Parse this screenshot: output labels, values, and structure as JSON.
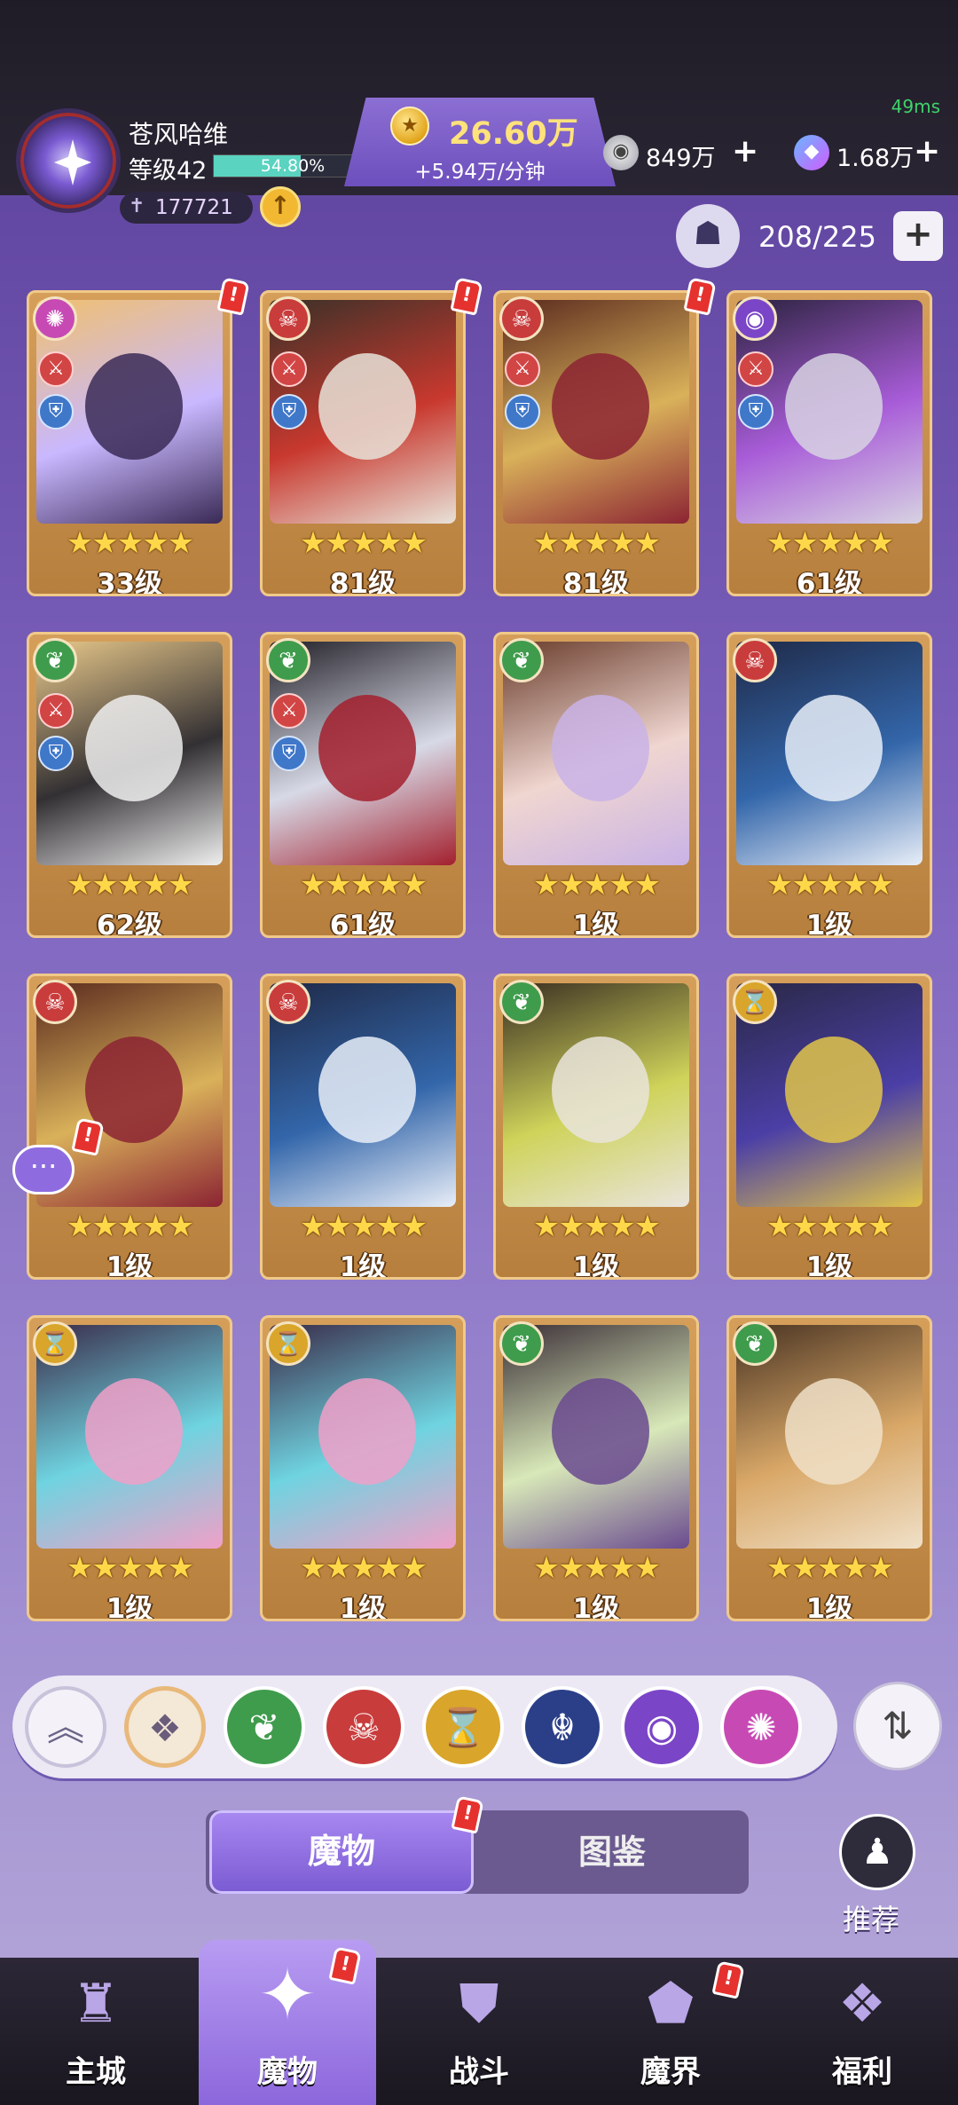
{
  "status": {
    "ping": "49ms"
  },
  "player": {
    "name": "苍风哈维",
    "level_label": "等级42",
    "xp_percent_text": "54.80%",
    "xp_fraction": 0.548,
    "power": "177721"
  },
  "gold": {
    "amount": "26.60万",
    "rate": "+5.94万/分钟"
  },
  "resources": {
    "silver": "849万",
    "gems": "1.68万"
  },
  "capacity": {
    "text": "208/225"
  },
  "cards": [
    {
      "level": "33级",
      "element": "wind-icon",
      "roles": [
        "attack",
        "defense"
      ],
      "alert": true,
      "art": [
        "#f0c070",
        "#c9b8ff",
        "#3a2a56"
      ]
    },
    {
      "level": "81级",
      "element": "fire-icon",
      "roles": [
        "attack",
        "defense"
      ],
      "alert": true,
      "art": [
        "#3a3128",
        "#c8382e",
        "#e8e2d8"
      ]
    },
    {
      "level": "81级",
      "element": "fire-icon",
      "roles": [
        "attack",
        "defense"
      ],
      "alert": true,
      "art": [
        "#5a2a1e",
        "#d9b15a",
        "#8c2433"
      ]
    },
    {
      "level": "61级",
      "element": "eye-icon",
      "roles": [
        "attack",
        "defense"
      ],
      "alert": false,
      "art": [
        "#2c2340",
        "#a85cd8",
        "#d7d2e2"
      ]
    },
    {
      "level": "62级",
      "element": "nature-icon",
      "roles": [
        "attack",
        "defense"
      ],
      "alert": false,
      "art": [
        "#e9c98b",
        "#333033",
        "#efefef"
      ]
    },
    {
      "level": "61级",
      "element": "nature-icon",
      "roles": [
        "attack",
        "defense"
      ],
      "alert": false,
      "art": [
        "#222028",
        "#d7d9e6",
        "#a3202e"
      ]
    },
    {
      "level": "1级",
      "element": "nature-icon",
      "roles": [],
      "alert": false,
      "art": [
        "#6a3d2c",
        "#f0d6d0",
        "#c9b3e6"
      ]
    },
    {
      "level": "1级",
      "element": "fire-icon",
      "roles": [],
      "alert": false,
      "art": [
        "#1f2a48",
        "#3366aa",
        "#e8eef8"
      ]
    },
    {
      "level": "1级",
      "element": "fire-icon",
      "roles": [],
      "alert": false,
      "art": [
        "#5a2a1e",
        "#d9b15a",
        "#8c2433"
      ]
    },
    {
      "level": "1级",
      "element": "fire-icon",
      "roles": [],
      "alert": false,
      "art": [
        "#1f2a48",
        "#3366aa",
        "#e8eef8"
      ]
    },
    {
      "level": "1级",
      "element": "nature-icon",
      "roles": [],
      "alert": false,
      "art": [
        "#3a2e22",
        "#cfd35a",
        "#e9e4dc"
      ]
    },
    {
      "level": "1级",
      "element": "time-icon",
      "roles": [],
      "alert": false,
      "art": [
        "#2a2846",
        "#4b3fa6",
        "#e0c44a"
      ]
    },
    {
      "level": "1级",
      "element": "time-icon",
      "roles": [],
      "alert": false,
      "art": [
        "#3a2c4a",
        "#6fd3e0",
        "#f0a0c8"
      ]
    },
    {
      "level": "1级",
      "element": "time-icon",
      "roles": [],
      "alert": false,
      "art": [
        "#3a2c4a",
        "#6fd3e0",
        "#f0a0c8"
      ]
    },
    {
      "level": "1级",
      "element": "nature-icon",
      "roles": [],
      "alert": false,
      "art": [
        "#3b2f38",
        "#d8e8b8",
        "#6a4a8f"
      ]
    },
    {
      "level": "1级",
      "element": "nature-icon",
      "roles": [],
      "alert": false,
      "art": [
        "#4a3423",
        "#d9a868",
        "#f0e0c8"
      ]
    }
  ],
  "filters": [
    "collapse",
    "all",
    "nature",
    "fire",
    "time",
    "beast",
    "eye",
    "wind"
  ],
  "tabs": {
    "active": "魔物",
    "inactive": "图鉴"
  },
  "recommend": {
    "label": "推荐"
  },
  "nav": [
    {
      "label": "主城",
      "icon": "castle-icon",
      "active": false,
      "alert": false
    },
    {
      "label": "魔物",
      "icon": "monster-icon",
      "active": true,
      "alert": true
    },
    {
      "label": "战斗",
      "icon": "battle-shield-icon",
      "active": false,
      "alert": false
    },
    {
      "label": "魔界",
      "icon": "portal-icon",
      "active": false,
      "alert": true
    },
    {
      "label": "福利",
      "icon": "treasure-chest-icon",
      "active": false,
      "alert": false
    }
  ]
}
